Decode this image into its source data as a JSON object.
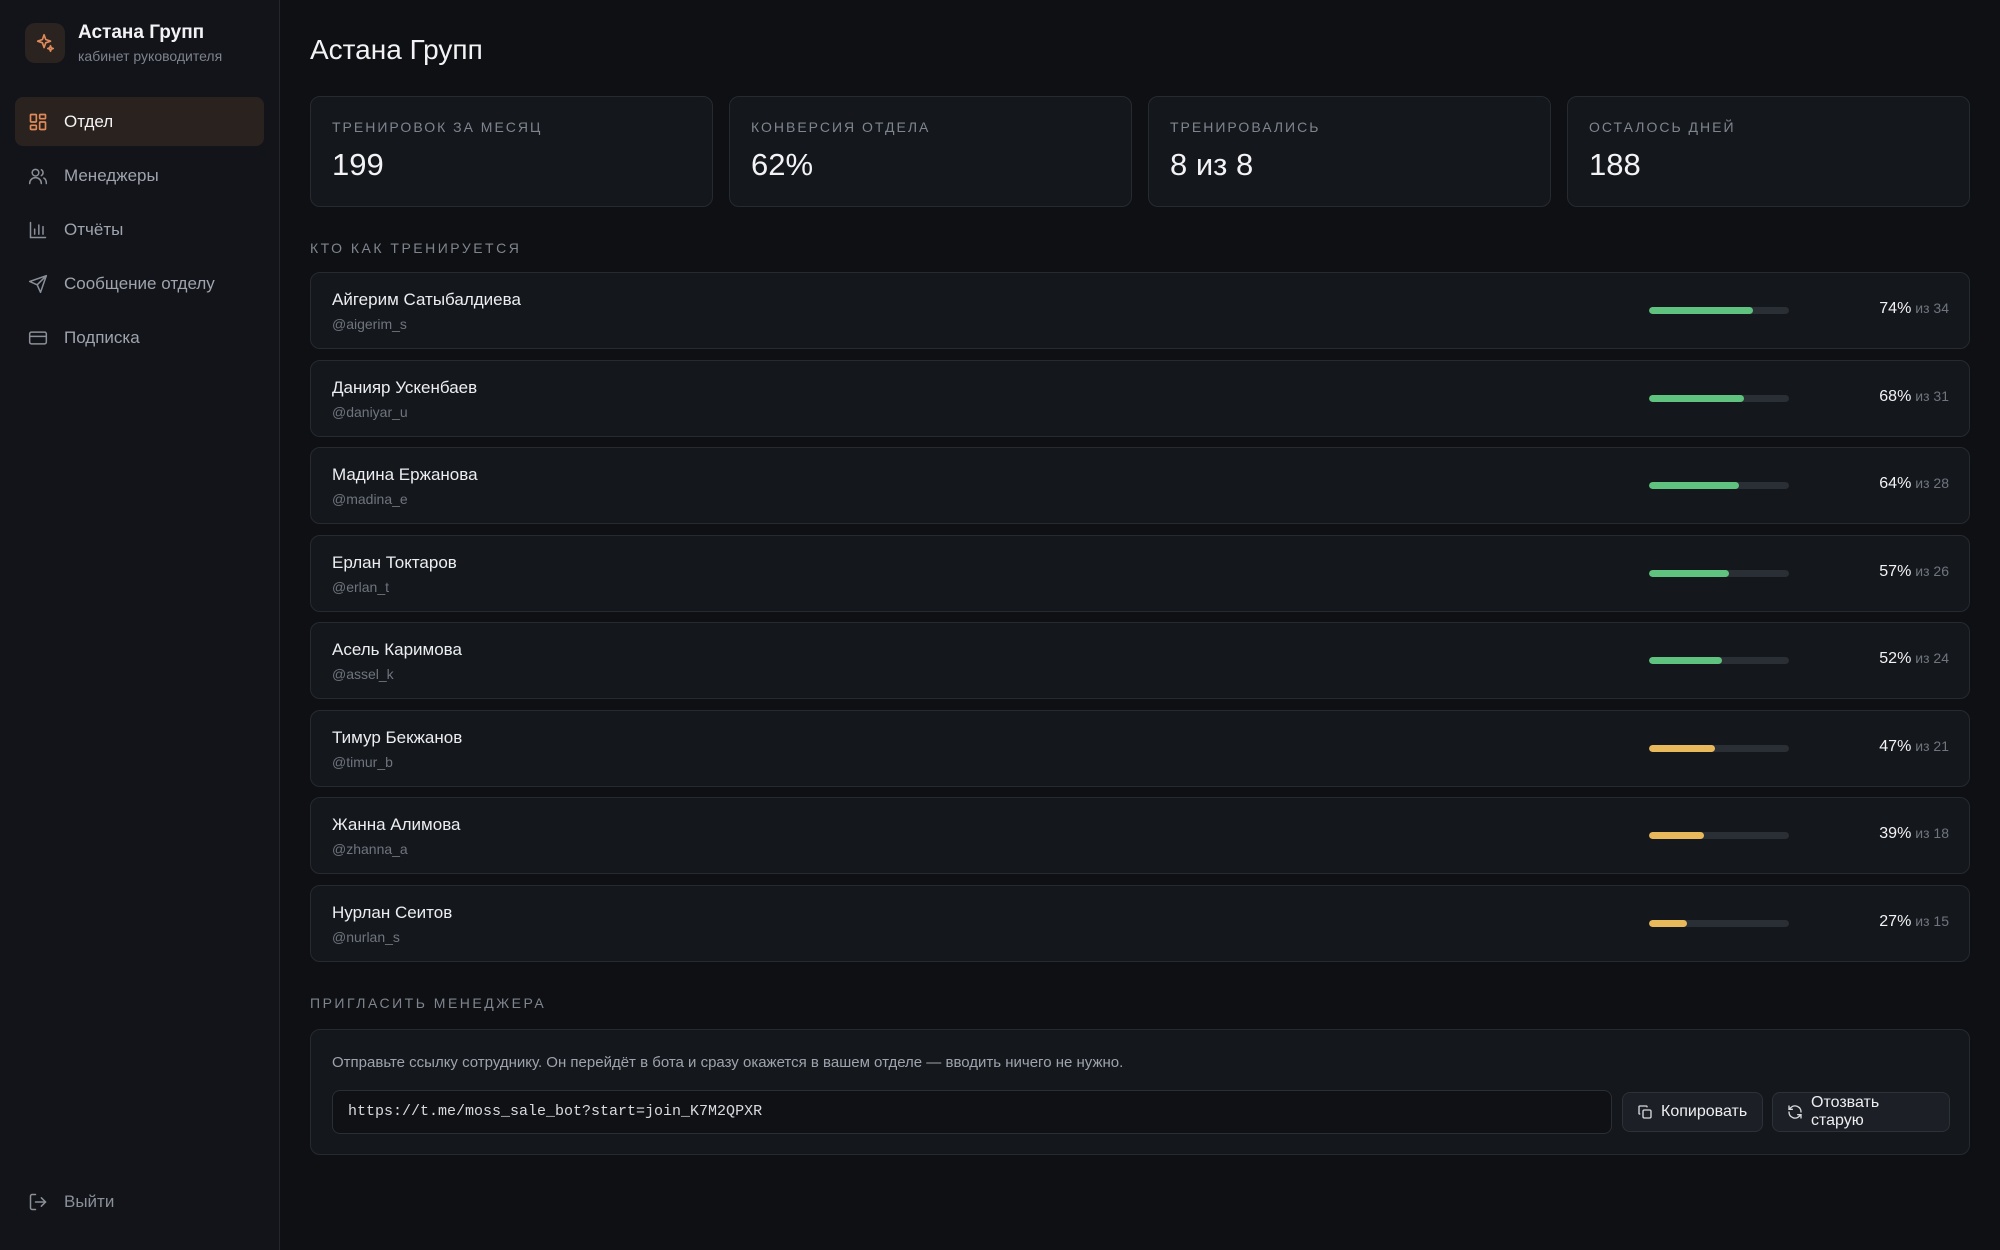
{
  "brand": {
    "title": "Астана Групп",
    "subtitle": "кабинет руководителя"
  },
  "nav": [
    {
      "label": "Отдел",
      "icon": "grid-icon",
      "active": true
    },
    {
      "label": "Менеджеры",
      "icon": "users-icon",
      "active": false
    },
    {
      "label": "Отчёты",
      "icon": "bar-chart-icon",
      "active": false
    },
    {
      "label": "Сообщение отделу",
      "icon": "send-icon",
      "active": false
    },
    {
      "label": "Подписка",
      "icon": "credit-card-icon",
      "active": false
    }
  ],
  "logout_label": "Выйти",
  "page_title": "Астана Групп",
  "stats": [
    {
      "label": "Тренировок за месяц",
      "value": "199"
    },
    {
      "label": "Конверсия отдела",
      "value": "62%"
    },
    {
      "label": "Тренировались",
      "value": "8 из 8"
    },
    {
      "label": "Осталось дней",
      "value": "188"
    }
  ],
  "team_section_label": "Кто как тренируется",
  "managers": [
    {
      "name": "Айгерим Сатыбалдиева",
      "handle": "@aigerim_s",
      "percent": 74,
      "percent_label": "74%",
      "of_label": "из 34"
    },
    {
      "name": "Данияр Ускенбаев",
      "handle": "@daniyar_u",
      "percent": 68,
      "percent_label": "68%",
      "of_label": "из 31"
    },
    {
      "name": "Мадина Ержанова",
      "handle": "@madina_e",
      "percent": 64,
      "percent_label": "64%",
      "of_label": "из 28"
    },
    {
      "name": "Ерлан Токтаров",
      "handle": "@erlan_t",
      "percent": 57,
      "percent_label": "57%",
      "of_label": "из 26"
    },
    {
      "name": "Асель Каримова",
      "handle": "@assel_k",
      "percent": 52,
      "percent_label": "52%",
      "of_label": "из 24"
    },
    {
      "name": "Тимур Бекжанов",
      "handle": "@timur_b",
      "percent": 47,
      "percent_label": "47%",
      "of_label": "из 21"
    },
    {
      "name": "Жанна Алимова",
      "handle": "@zhanna_a",
      "percent": 39,
      "percent_label": "39%",
      "of_label": "из 18"
    },
    {
      "name": "Нурлан Сеитов",
      "handle": "@nurlan_s",
      "percent": 27,
      "percent_label": "27%",
      "of_label": "из 15"
    }
  ],
  "colors": {
    "accent": "#e08a5a",
    "good": "#5fc27e",
    "warn": "#e8b95a"
  },
  "invite": {
    "section_label": "Пригласить менеджера",
    "description": "Отправьте ссылку сотруднику. Он перейдёт в бота и сразу окажется в вашем отделе — вводить ничего не нужно.",
    "link": "https://t.me/moss_sale_bot?start=join_K7M2QPXR",
    "copy_label": "Копировать",
    "revoke_label": "Отозвать старую"
  }
}
